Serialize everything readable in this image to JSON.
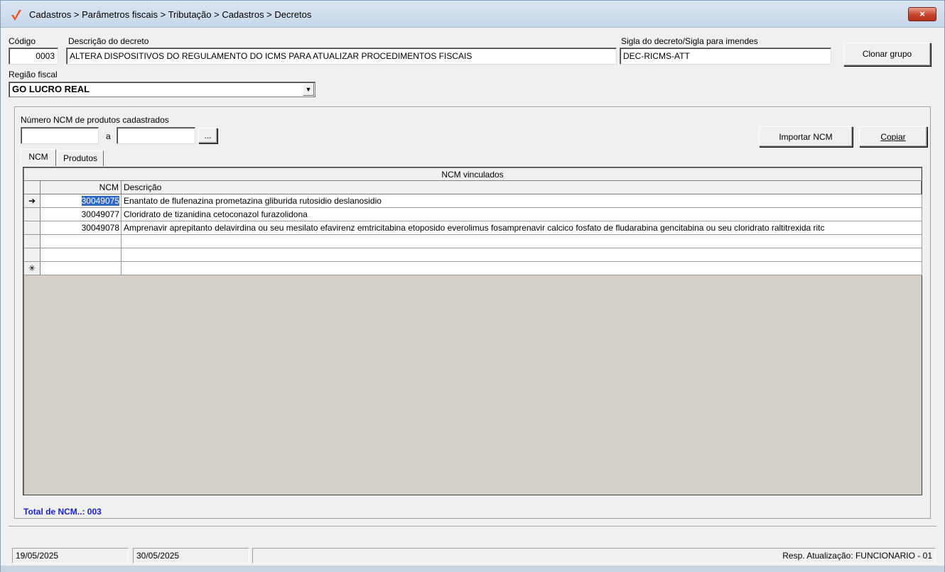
{
  "window": {
    "title": "Cadastros > Parâmetros fiscais > Tributação > Cadastros > Decretos",
    "close_glyph": "×"
  },
  "form": {
    "codigo_label": "Código",
    "codigo_value": "0003",
    "descricao_label": "Descrição do decreto",
    "descricao_value": "ALTERA DISPOSITIVOS DO REGULAMENTO DO ICMS PARA ATUALIZAR PROCEDIMENTOS FISCAIS",
    "sigla_label": "Sigla do decreto/Sigla para imendes",
    "sigla_value": "DEC-RICMS-ATT",
    "clonar_label": "Clonar grupo",
    "regiao_label": "Região fiscal",
    "regiao_value": "GO LUCRO REAL"
  },
  "filter": {
    "label": "Número  NCM de produtos cadastrados",
    "from_value": "",
    "sep": "a",
    "to_value": "",
    "browse_label": "...",
    "importar_label": "Importar NCM",
    "copiar_label": "Copiar"
  },
  "tabs": [
    {
      "label": "NCM",
      "active": true
    },
    {
      "label": "Produtos",
      "active": false
    }
  ],
  "grid": {
    "caption": "NCM vinculados",
    "columns": [
      "NCM",
      "Descrição"
    ],
    "rows": [
      {
        "indicator": "➔",
        "ncm": "30049075",
        "descricao": "Enantato de flufenazina  prometazina  gliburida  rutosidio  deslanosidio"
      },
      {
        "indicator": "",
        "ncm": "30049077",
        "descricao": "Cloridrato de tizanidina  cetoconazol  furazolidona"
      },
      {
        "indicator": "",
        "ncm": "30049078",
        "descricao": "Amprenavir  aprepitanto  delavirdina ou seu mesilato  efavirenz  emtricitabina  etoposido  everolimus  fosamprenavir calcico  fosfato de fludarabina  gencitabina ou seu cloridrato  raltitrexida  ritc"
      },
      {
        "indicator": "",
        "ncm": "",
        "descricao": ""
      },
      {
        "indicator": "",
        "ncm": "",
        "descricao": ""
      },
      {
        "indicator": "✳",
        "ncm": "",
        "descricao": ""
      }
    ]
  },
  "total_label": "Total de NCM..: 003",
  "status": {
    "created": "19/05/2025",
    "updated": "30/05/2025",
    "empty": "",
    "resp": "Resp. Atualização: FUNCIONARIO - 01"
  },
  "icons": {
    "logo": "check-logo-icon",
    "close": "close-icon",
    "dropdown": "chevron-down-icon",
    "row_pointer": "arrow-right-icon",
    "new_row": "asterisk-icon"
  },
  "colors": {
    "title_bar": "#c7d6e8",
    "close_button": "#c7442b",
    "selection": "#316ac5",
    "total_text": "#1a22c8",
    "logo": "#e8501c"
  }
}
